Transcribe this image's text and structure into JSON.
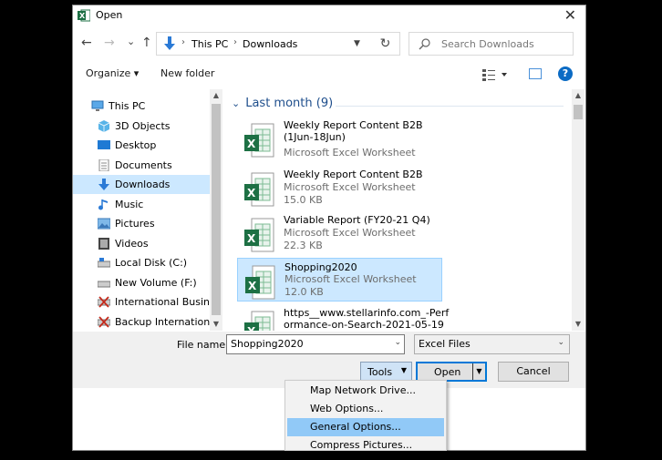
{
  "window": {
    "title": "Open",
    "close_glyph": "✕"
  },
  "nav": {
    "back": "←",
    "forward": "→",
    "recent": "⌄",
    "up": "↑",
    "breadcrumbs": [
      "This PC",
      "Downloads"
    ],
    "refresh": "↻",
    "search_placeholder": "Search Downloads"
  },
  "toolbar": {
    "organize": "Organize ▾",
    "new_folder": "New folder",
    "help": "?"
  },
  "sidebar": {
    "items": [
      {
        "label": "This PC",
        "icon": "pc-icon"
      },
      {
        "label": "3D Objects",
        "icon": "3d-objects-icon"
      },
      {
        "label": "Desktop",
        "icon": "desktop-icon"
      },
      {
        "label": "Documents",
        "icon": "documents-icon"
      },
      {
        "label": "Downloads",
        "icon": "downloads-icon",
        "selected": true
      },
      {
        "label": "Music",
        "icon": "music-icon"
      },
      {
        "label": "Pictures",
        "icon": "pictures-icon"
      },
      {
        "label": "Videos",
        "icon": "videos-icon"
      },
      {
        "label": "Local Disk (C:)",
        "icon": "drive-icon"
      },
      {
        "label": "New Volume (F:)",
        "icon": "drive-icon"
      },
      {
        "label": "International Business",
        "icon": "network-drive-icon"
      },
      {
        "label": "Backup International I",
        "icon": "network-drive-icon"
      }
    ]
  },
  "content": {
    "group_header": "Last month (9)",
    "files": [
      {
        "name": "Weekly Report Content B2B\n(1Jun-18Jun)",
        "type": "Microsoft Excel Worksheet",
        "size": ""
      },
      {
        "name": "Weekly Report Content B2B",
        "type": "Microsoft Excel Worksheet",
        "size": "15.0 KB"
      },
      {
        "name": "Variable Report (FY20-21 Q4)",
        "type": "Microsoft Excel Worksheet",
        "size": "22.3 KB"
      },
      {
        "name": "Shopping2020",
        "type": "Microsoft Excel Worksheet",
        "size": "12.0 KB",
        "selected": true
      },
      {
        "name": "https__www.stellarinfo.com_-Perf\normance-on-Search-2021-05-19",
        "type": "",
        "size": ""
      }
    ]
  },
  "footer": {
    "file_name_label": "File name:",
    "file_name_value": "Shopping2020",
    "filter_value": "Excel Files",
    "tools_label": "Tools",
    "open_label": "Open",
    "cancel_label": "Cancel"
  },
  "tools_menu": {
    "items": [
      {
        "label": "Map Network Drive..."
      },
      {
        "label": "Web Options..."
      },
      {
        "label": "General Options...",
        "highlighted": true
      },
      {
        "label": "Compress Pictures..."
      }
    ]
  },
  "colors": {
    "accent": "#0078d7",
    "selection": "#cce8ff",
    "menu_highlight": "#91c9f7",
    "excel_green": "#1d7044"
  }
}
